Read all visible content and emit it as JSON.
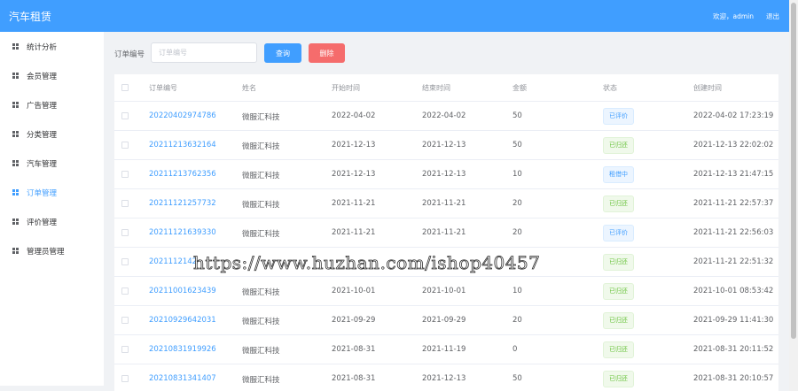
{
  "header": {
    "title": "汽车租赁",
    "welcome": "欢迎，admin",
    "logout": "退出"
  },
  "sidebar": {
    "items": [
      {
        "label": "统计分析",
        "active": false
      },
      {
        "label": "会员管理",
        "active": false
      },
      {
        "label": "广告管理",
        "active": false
      },
      {
        "label": "分类管理",
        "active": false
      },
      {
        "label": "汽车管理",
        "active": false
      },
      {
        "label": "订单管理",
        "active": true
      },
      {
        "label": "评价管理",
        "active": false
      },
      {
        "label": "管理员管理",
        "active": false
      }
    ]
  },
  "search": {
    "label": "订单编号",
    "placeholder": "订单编号",
    "query_label": "查询",
    "delete_label": "删除"
  },
  "table": {
    "headers": [
      "订单编号",
      "姓名",
      "开始时间",
      "结束时间",
      "金额",
      "状态",
      "创建时间"
    ],
    "rows": [
      {
        "order_no": "20220402974786",
        "name": "微服汇科技",
        "start": "2022-04-02",
        "end": "2022-04-02",
        "amount": "50",
        "status": "已评价",
        "status_color": "blue",
        "created": "2022-04-02 17:23:19"
      },
      {
        "order_no": "20211213632164",
        "name": "微服汇科技",
        "start": "2021-12-13",
        "end": "2021-12-13",
        "amount": "50",
        "status": "已归还",
        "status_color": "green",
        "created": "2021-12-13 22:02:02"
      },
      {
        "order_no": "20211213762356",
        "name": "微服汇科技",
        "start": "2021-12-13",
        "end": "2021-12-13",
        "amount": "10",
        "status": "租借中",
        "status_color": "blue",
        "created": "2021-12-13 21:47:15"
      },
      {
        "order_no": "20211121257732",
        "name": "微服汇科技",
        "start": "2021-11-21",
        "end": "2021-11-21",
        "amount": "20",
        "status": "已归还",
        "status_color": "green",
        "created": "2021-11-21 22:57:37"
      },
      {
        "order_no": "20211121639330",
        "name": "微服汇科技",
        "start": "2021-11-21",
        "end": "2021-11-21",
        "amount": "20",
        "status": "已评价",
        "status_color": "blue",
        "created": "2021-11-21 22:56:03"
      },
      {
        "order_no": "2021112142",
        "name": "",
        "start": "",
        "end": "",
        "amount": "",
        "status": "已归还",
        "status_color": "green",
        "created": "2021-11-21 22:51:32"
      },
      {
        "order_no": "20211001623439",
        "name": "微服汇科技",
        "start": "2021-10-01",
        "end": "2021-10-01",
        "amount": "10",
        "status": "已归还",
        "status_color": "green",
        "created": "2021-10-01 08:53:42"
      },
      {
        "order_no": "20210929642031",
        "name": "微服汇科技",
        "start": "2021-09-29",
        "end": "2021-09-29",
        "amount": "20",
        "status": "已归还",
        "status_color": "green",
        "created": "2021-09-29 11:41:30"
      },
      {
        "order_no": "20210831919926",
        "name": "微服汇科技",
        "start": "2021-08-31",
        "end": "2021-11-19",
        "amount": "0",
        "status": "已归还",
        "status_color": "green",
        "created": "2021-08-31 20:11:52"
      },
      {
        "order_no": "20210831341407",
        "name": "微服汇科技",
        "start": "2021-08-31",
        "end": "2021-12-13",
        "amount": "50",
        "status": "已归还",
        "status_color": "green",
        "created": "2021-08-31 20:10:57"
      }
    ]
  },
  "watermark": "https://www.huzhan.com/ishop40457"
}
